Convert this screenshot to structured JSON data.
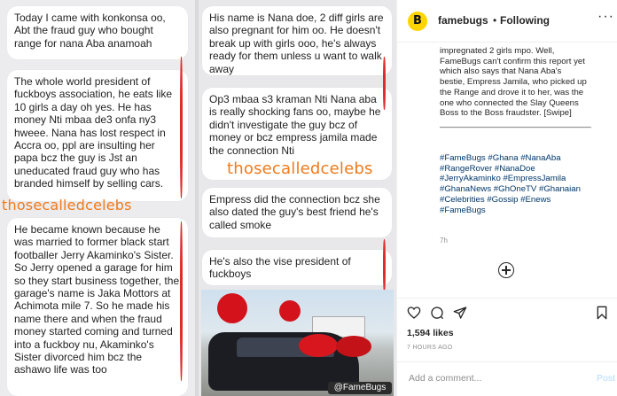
{
  "screenshot": {
    "left_column": [
      "Today I came with konkonsa oo, Abt the fraud guy who bought range for nana Aba anamoah",
      "The whole world president of fuckboys association, he eats like 10 girls a day oh yes. He has money Nti mbaa de3 onfa ny3 hweee. Nana has lost respect in Accra oo, ppl are insulting her papa bcz the guy is Jst an uneducated fraud guy who has branded himself by selling cars.",
      "He became known because he was married to former black start footballer Jerry Akaminko's Sister. So Jerry opened a garage for him so they start business together, the garage's name is Jaka Mottors at Achimota mile 7. So he made his name there and when the fraud money started coming and turned into a fuckboy nu, Akaminko's Sister divorced him bcz the ashawo life was too"
    ],
    "right_column": [
      "His name is Nana doe, 2 diff girls are also pregnant for him oo. He doesn't break up with girls ooo, he's always ready for them unless u want to walk away",
      "Op3 mbaa s3 kraman Nti Nana aba is really shocking fans oo, maybe he didn't investigate the guy bcz of money or bcz empress jamila made the connection Nti",
      "Empress did the connection bcz she also dated the guy's best friend he's called smoke",
      "He's also the vise president of fuckboys"
    ],
    "watermark": "thosecalledcelebs",
    "photo_tag": "@FameBugs"
  },
  "post": {
    "avatar_letter": "B",
    "username": "famebugs",
    "dot": "•",
    "follow_status": "Following",
    "more": "···",
    "caption_lines": [
      "impregnated 2 girls mpo. Well,",
      "FameBugs can't confirm this report yet",
      "which also says that Nana Aba's",
      "bestie, Empress Jamila, who picked up",
      "the Range and drove it to her, was the",
      "one who connected the Slay Queens",
      "Boss to the Boss fraudster. [Swipe]",
      "________________________________"
    ],
    "hashtags": [
      "#FameBugs #Ghana #NanaAba",
      "#RangeRover #NanaDoe",
      "#JerryAkaminko #EmpressJamila",
      "#GhanaNews #GhOneTV #Ghanaian",
      "#Celebrities #Gossip #Enews",
      "#FameBugs"
    ],
    "caption_time": "7h",
    "likes": "1,594 likes",
    "posted_ago": "7 HOURS AGO",
    "comment_placeholder": "Add a comment...",
    "post_label": "Post"
  },
  "colors": {
    "watermark": "#f07a1a",
    "red_marks": "#e02b2b",
    "link": "#00376b",
    "post_disabled": "#b3dbff"
  }
}
